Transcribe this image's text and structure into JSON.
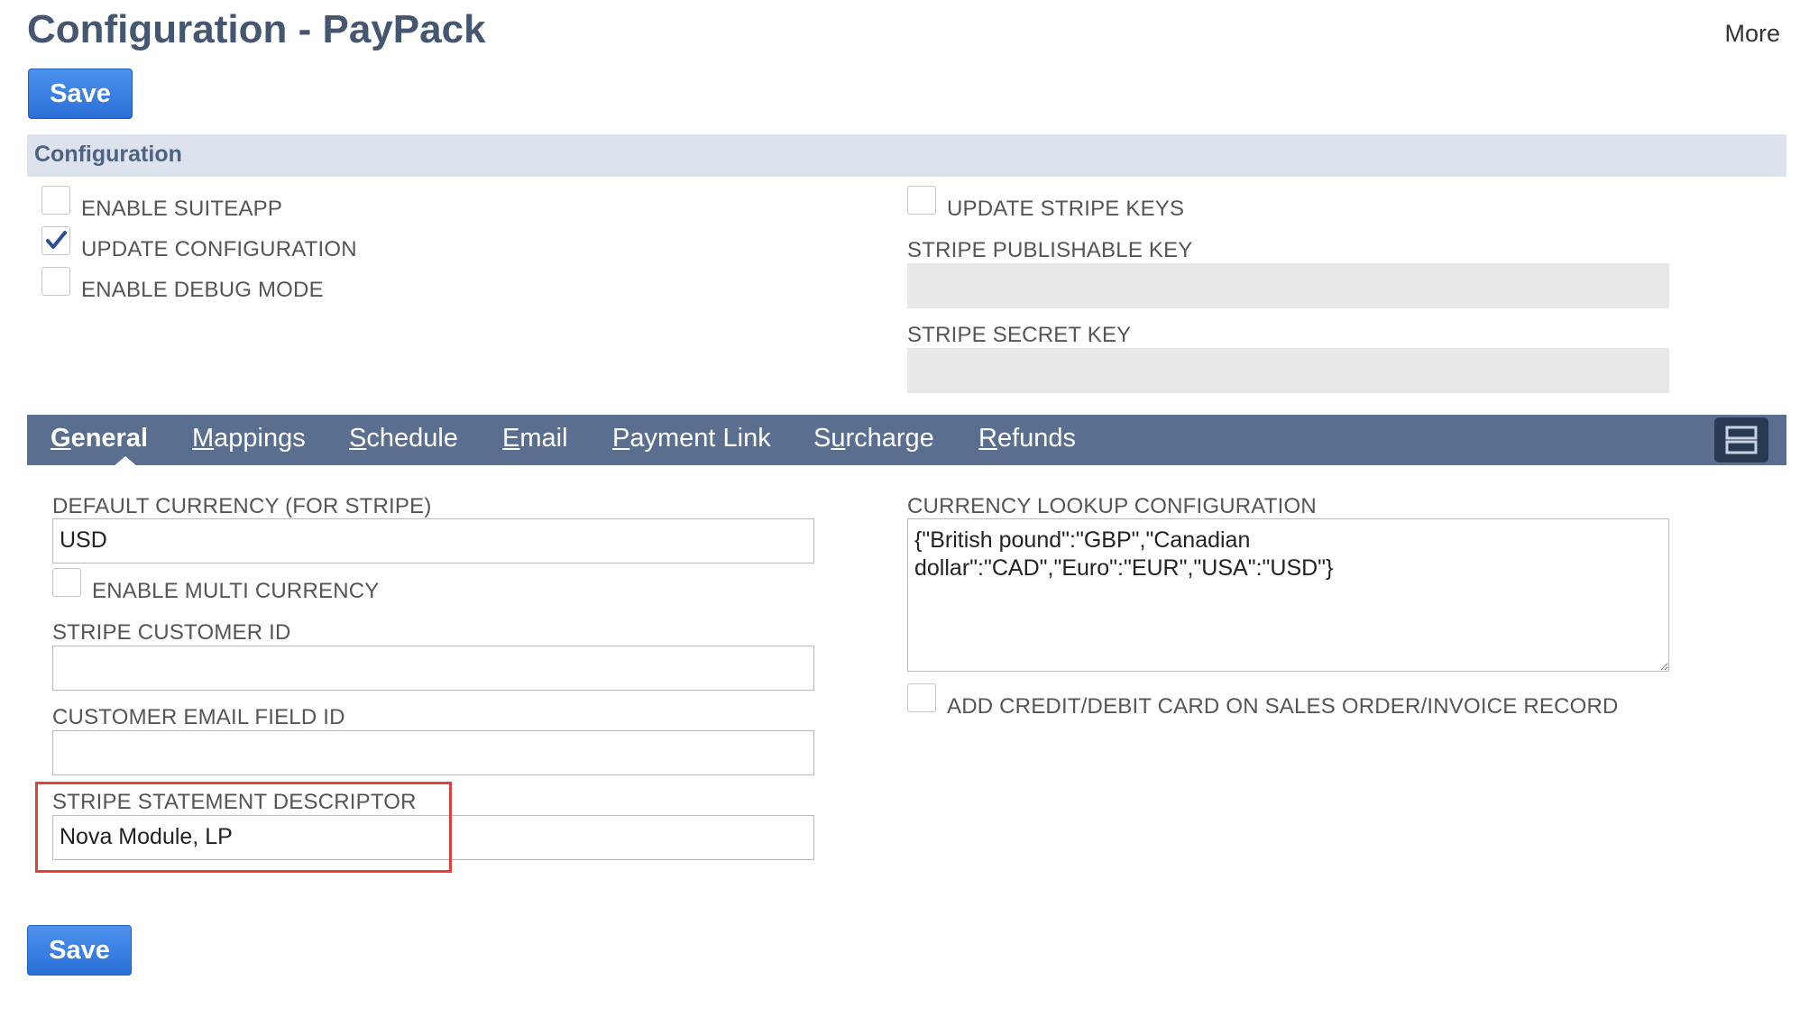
{
  "header": {
    "title": "Configuration - PayPack",
    "more_label": "More",
    "save_label": "Save"
  },
  "configuration": {
    "section_title": "Configuration",
    "enable_suiteapp": {
      "label": "ENABLE SUITEAPP",
      "checked": false
    },
    "update_configuration": {
      "label": "UPDATE CONFIGURATION",
      "checked": true
    },
    "enable_debug_mode": {
      "label": "ENABLE DEBUG MODE",
      "checked": false
    },
    "update_stripe_keys": {
      "label": "UPDATE STRIPE KEYS",
      "checked": false
    },
    "stripe_publishable_key": {
      "label": "STRIPE PUBLISHABLE KEY",
      "value": ""
    },
    "stripe_secret_key": {
      "label": "STRIPE SECRET KEY",
      "value": ""
    }
  },
  "tabs": [
    {
      "accel": "G",
      "rest": "eneral",
      "active": true
    },
    {
      "accel": "M",
      "rest": "appings",
      "active": false
    },
    {
      "accel": "S",
      "rest": "chedule",
      "active": false
    },
    {
      "accel": "E",
      "rest": "mail",
      "active": false
    },
    {
      "accel": "P",
      "rest": "ayment Link",
      "active": false
    },
    {
      "pre": "S",
      "accel": "u",
      "rest": "rcharge",
      "active": false
    },
    {
      "accel": "R",
      "rest": "efunds",
      "active": false
    }
  ],
  "general": {
    "default_currency": {
      "label": "DEFAULT CURRENCY (FOR STRIPE)",
      "value": "USD"
    },
    "enable_multi_currency": {
      "label": "ENABLE MULTI CURRENCY",
      "checked": false
    },
    "stripe_customer_id": {
      "label": "STRIPE CUSTOMER ID",
      "value": ""
    },
    "customer_email_field_id": {
      "label": "CUSTOMER EMAIL FIELD ID",
      "value": ""
    },
    "stripe_statement_descriptor": {
      "label": "STRIPE STATEMENT DESCRIPTOR",
      "value": "Nova Module, LP"
    },
    "currency_lookup": {
      "label": "CURRENCY LOOKUP CONFIGURATION",
      "value": "{\"British pound\":\"GBP\",\"Canadian dollar\":\"CAD\",\"Euro\":\"EUR\",\"USA\":\"USD\"}"
    },
    "add_card": {
      "label": "ADD CREDIT/DEBIT CARD ON SALES ORDER/INVOICE RECORD",
      "checked": false
    }
  },
  "colors": {
    "title": "#445670",
    "button": "#2a6fd6",
    "section_header_bg": "#dde3ec",
    "tabbar_bg": "#5a6e8f",
    "highlight": "#e0403a"
  }
}
